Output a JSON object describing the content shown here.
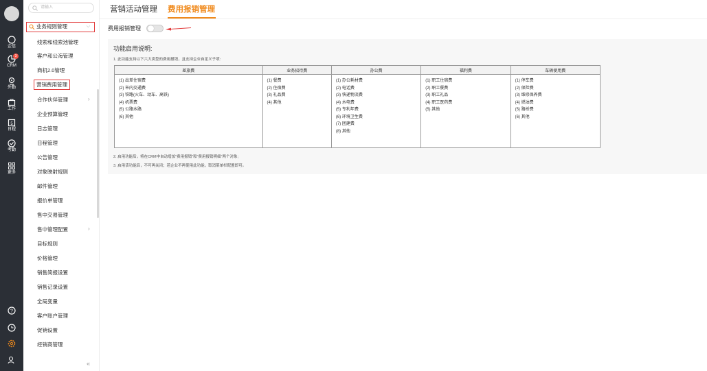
{
  "rail": {
    "items": [
      {
        "label": "企信",
        "icon": "chat-icon"
      },
      {
        "label": "CRM",
        "icon": "crm-icon",
        "badge": "3"
      },
      {
        "label": "外勤",
        "icon": "location-icon"
      },
      {
        "label": "工作",
        "icon": "briefcase-icon"
      },
      {
        "label": "日程",
        "icon": "calendar-icon",
        "day": "5"
      },
      {
        "label": "考勤",
        "icon": "check-icon"
      },
      {
        "label": "更多",
        "icon": "grid-icon"
      }
    ],
    "bottom_icons": [
      "help-icon",
      "clock-icon",
      "settings-icon",
      "user-icon"
    ]
  },
  "menu": {
    "search_placeholder": "请输入",
    "parent": "业务规则管理",
    "items": [
      {
        "label": "线索和线索池管理"
      },
      {
        "label": "客户和公海管理"
      },
      {
        "label": "商机2.0管理"
      },
      {
        "label": "营销费用管理",
        "active": true
      },
      {
        "label": "合作伙伴管理",
        "arrow": "›"
      },
      {
        "label": "企业预算管理"
      },
      {
        "label": "日志管理"
      },
      {
        "label": "日程管理"
      },
      {
        "label": "公告管理"
      },
      {
        "label": "对象映射规则"
      },
      {
        "label": "邮件管理"
      },
      {
        "label": "报价单管理"
      },
      {
        "label": "售中交易管理"
      },
      {
        "label": "售中管理配置",
        "arrow": "›"
      },
      {
        "label": "目标规则"
      },
      {
        "label": "价格管理"
      },
      {
        "label": "销售简报设置"
      },
      {
        "label": "销售记录设置"
      },
      {
        "label": "全局变量"
      },
      {
        "label": "客户账户管理"
      },
      {
        "label": "促销设置"
      },
      {
        "label": "经销商管理"
      }
    ],
    "collapse": "«"
  },
  "tabs": [
    {
      "label": "营销活动管理"
    },
    {
      "label": "费用报销管理",
      "active": true
    }
  ],
  "toggle": {
    "label": "费用报销管理",
    "on": false
  },
  "panel": {
    "title": "功能启用说明:",
    "line1": "1. 此功能支持以下六大类型的费用报销，且支持企业自定义子项:",
    "line2": "2. 启用功能后，将在CRM中自动增加\"费用报销\"和\"费用报销明细\"两个对象;",
    "line3": "3. 启用该功能后，不可再关闭；若企业不再使用此功能，取消菜单栏配置即可。",
    "columns": [
      {
        "header": "差旅费",
        "items": [
          "(1) 出差住宿费",
          "(2) 市内交通费",
          "(3) 铁路(火车、动车、高铁)",
          "(4) 机票费",
          "(5) 公路水路",
          "(6) 其他"
        ]
      },
      {
        "header": "业务招待费",
        "items": [
          "(1) 餐费",
          "(2) 住宿费",
          "(3) 礼品费",
          "(4) 其他"
        ]
      },
      {
        "header": "办公费",
        "items": [
          "(1) 办公耗材费",
          "(2) 电话费",
          "(3) 快递物流费",
          "(4) 水电费",
          "(5) 专利年费",
          "(6) 环境卫生费",
          "(7) 团建费",
          "(8) 其他"
        ]
      },
      {
        "header": "福利费",
        "items": [
          "(1) 职工住宿费",
          "(2) 职工餐费",
          "(3) 职工礼品",
          "(4) 职工医药费",
          "(5) 其他"
        ]
      },
      {
        "header": "车辆使用费",
        "items": [
          "(1) 停车费",
          "(2) 保险费",
          "(3) 维修保养费",
          "(4) 燃油费",
          "(5) 路桥费",
          "(6) 其他"
        ]
      }
    ]
  },
  "colors": {
    "accent": "#f08a1c",
    "highlight": "#e23c3c",
    "rail": "#2b2f36"
  }
}
